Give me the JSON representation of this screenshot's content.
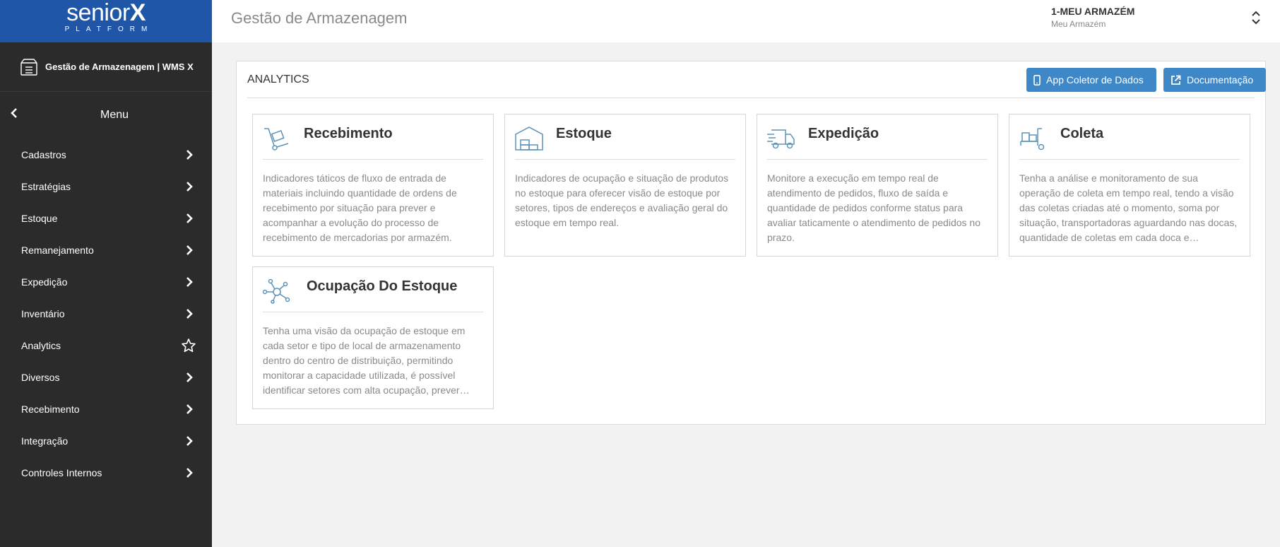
{
  "brand": {
    "name_light": "senior",
    "name_bold": "X",
    "platform": "PLATFORM"
  },
  "module": {
    "title": "Gestão de Armazenagem | WMS X"
  },
  "menu": {
    "title": "Menu",
    "items": [
      {
        "label": "Cadastros",
        "icon": "chevron-right-icon"
      },
      {
        "label": "Estratégias",
        "icon": "chevron-right-icon"
      },
      {
        "label": "Estoque",
        "icon": "chevron-right-icon"
      },
      {
        "label": "Remanejamento",
        "icon": "chevron-right-icon"
      },
      {
        "label": "Expedição",
        "icon": "chevron-right-icon"
      },
      {
        "label": "Inventário",
        "icon": "chevron-right-icon"
      },
      {
        "label": "Analytics",
        "icon": "star-icon"
      },
      {
        "label": "Diversos",
        "icon": "chevron-right-icon"
      },
      {
        "label": "Recebimento",
        "icon": "chevron-right-icon"
      },
      {
        "label": "Integração",
        "icon": "chevron-right-icon"
      },
      {
        "label": "Controles Internos",
        "icon": "chevron-right-icon"
      }
    ]
  },
  "header": {
    "title": "Gestão de Armazenagem",
    "warehouse_name": "1-MEU ARMAZÉM",
    "warehouse_sub": "Meu Armazém"
  },
  "panel": {
    "title": "ANALYTICS",
    "btn_app": "App Coletor de Dados",
    "btn_doc": "Documentação"
  },
  "cards": [
    {
      "title": "Recebimento",
      "icon": "hand-truck-icon",
      "desc": "Indicadores táticos de fluxo de entrada de materiais incluindo quantidade de ordens de recebimento por situação para prever e acompanhar a evolução do processo de recebimento de mercadorias por armazém."
    },
    {
      "title": "Estoque",
      "icon": "warehouse-icon",
      "desc": "Indicadores de ocupação e situação de produtos no estoque para oferecer visão de estoque por setores, tipos de endereços e avaliação geral do estoque em tempo real."
    },
    {
      "title": "Expedição",
      "icon": "delivery-truck-icon",
      "desc": "Monitore a execução em tempo real de atendimento de pedidos, fluxo de saída e quantidade de pedidos conforme status para avaliar taticamente o atendimento de pedidos no prazo."
    },
    {
      "title": "Coleta",
      "icon": "cart-boxes-icon",
      "desc": "Tenha a análise e monitoramento de sua operação de coleta em tempo real, tendo a visão das coletas criadas até o momento, soma por situação, transportadoras aguardando nas docas, quantidade de coletas em cada doca e…"
    },
    {
      "title": "Ocupação Do Estoque",
      "icon": "network-nodes-icon",
      "desc": "Tenha uma visão da ocupação de estoque em cada setor e tipo de local de armazenamento dentro do centro de distribuição, permitindo monitorar a capacidade utilizada, é possível identificar setores com alta ocupação, prever…"
    }
  ],
  "colors": {
    "brand_blue": "#1f56a8",
    "sidebar": "#2b2b2b",
    "button": "#3f88c8",
    "icon_accent": "#5b93b8"
  }
}
